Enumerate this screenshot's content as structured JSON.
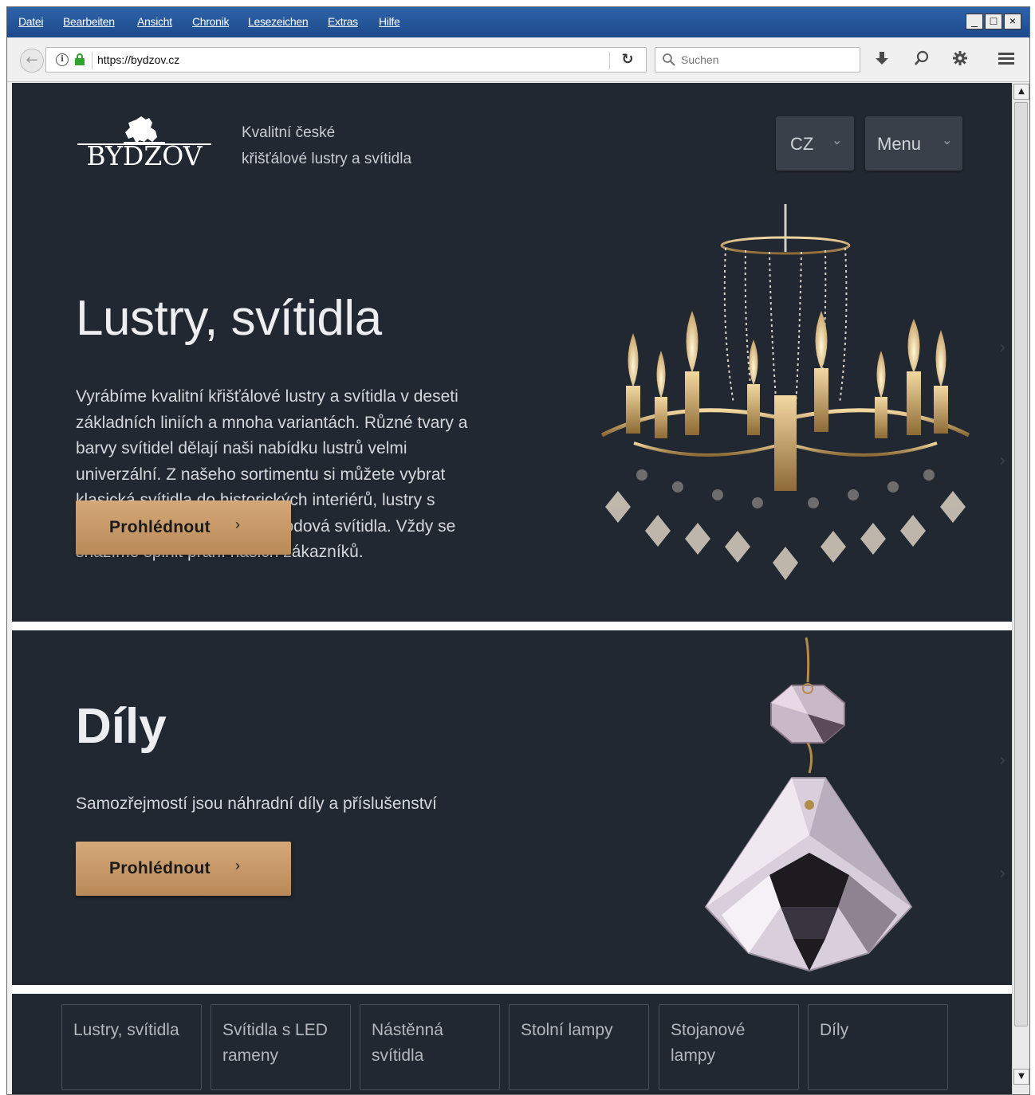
{
  "browser": {
    "menu": [
      "Datei",
      "Bearbeiten",
      "Ansicht",
      "Chronik",
      "Lesezeichen",
      "Extras",
      "Hilfe"
    ],
    "window_buttons": [
      "_",
      "□",
      "×"
    ],
    "url": "https://bydzov.cz",
    "search_placeholder": "Suchen",
    "icons": [
      "back-icon",
      "info-icon",
      "lock-icon",
      "reload-icon",
      "search-icon",
      "download-icon",
      "magnifier-icon",
      "addon-icon",
      "hamburger-menu-icon"
    ]
  },
  "site": {
    "logo_text": "BYDZOV",
    "tagline_line1": "Kvalitní české",
    "tagline_line2": "křišťálové lustry a svítidla",
    "lang_label": "CZ",
    "menu_label": "Menu"
  },
  "hero1": {
    "title": "Lustry, svítidla",
    "body": "Vyrábíme kvalitní křišťálové lustry a svítidla v deseti základních liniích a mnoha variantách. Různé tvary a barvy svítidel dělají naši nabídku lustrů velmi univerzální. Z našeho sortimentu si můžete vybrat klasická svítidla do historických interiérů, lustry s moderním designem nebo bodová svítidla. Vždy se snažíme splnit přání našich zákazníků.",
    "button_label": "Prohlédnout"
  },
  "hero2": {
    "title": "Díly",
    "subtitle": "Samozřejmostí jsou náhradní díly a příslušenství",
    "button_label": "Prohlédnout"
  },
  "categories": [
    {
      "label": "Lustry, svítidla"
    },
    {
      "label": "Svítidla s LED rameny"
    },
    {
      "label": "Nástěnná svítidla"
    },
    {
      "label": "Stolní lampy"
    },
    {
      "label": "Stojanové lampy"
    },
    {
      "label": "Díly"
    }
  ],
  "colors": {
    "page_bg": "#222831",
    "accent_button": "#c99a68",
    "menubar": "#1f4f91"
  }
}
